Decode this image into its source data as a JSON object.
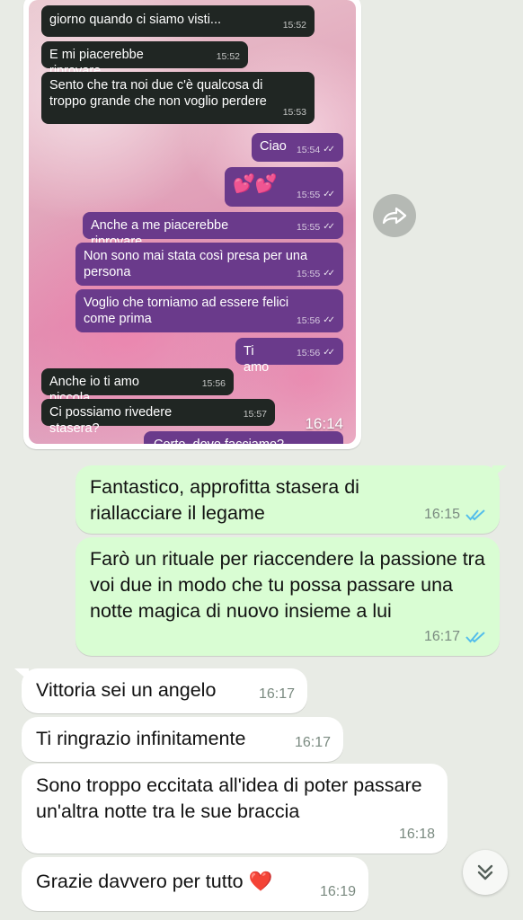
{
  "screenshot": {
    "messages": [
      {
        "dir": "in",
        "text": "giorno quando ci siamo visti...",
        "time": "15:52"
      },
      {
        "dir": "in",
        "text": "E mi piacerebbe riprovare",
        "time": "15:52"
      },
      {
        "dir": "in",
        "text": "Sento che tra noi due c'è qualcosa di troppo grande che non voglio perdere",
        "time": "15:53"
      },
      {
        "dir": "out",
        "text": "Ciao",
        "time": "15:54"
      },
      {
        "dir": "out",
        "text": "💕💕",
        "time": "15:55"
      },
      {
        "dir": "out",
        "text": "Anche a me piacerebbe riprovare",
        "time": "15:55"
      },
      {
        "dir": "out",
        "text": "Non sono mai stata così presa per una persona",
        "time": "15:55"
      },
      {
        "dir": "out",
        "text": "Voglio che torniamo ad essere felici come prima",
        "time": "15:56"
      },
      {
        "dir": "out",
        "text": "Ti amo",
        "time": "15:56"
      },
      {
        "dir": "in",
        "text": "Anche io ti amo piccola",
        "time": "15:56"
      },
      {
        "dir": "in",
        "text": "Ci possiamo rivedere stasera?",
        "time": "15:57"
      },
      {
        "dir": "out",
        "text": "Certo, dove facciamo?",
        "time": ""
      }
    ],
    "overlay_time": "16:14"
  },
  "chat": {
    "messages": [
      {
        "dir": "out",
        "text": "Fantastico, approfitta stasera di riallacciare il legame",
        "time": "16:15",
        "status": "read"
      },
      {
        "dir": "out",
        "text": "Farò un rituale per riaccendere la passione tra voi due in modo che tu possa passare una notte magica di nuovo insieme a lui",
        "time": "16:17",
        "status": "read"
      },
      {
        "dir": "in",
        "text": "Vittoria sei un angelo",
        "time": "16:17"
      },
      {
        "dir": "in",
        "text": "Ti ringrazio infinitamente",
        "time": "16:17"
      },
      {
        "dir": "in",
        "text": "Sono troppo eccitata all'idea di poter passare un'altra notte tra le sue braccia",
        "time": "16:18"
      },
      {
        "dir": "in",
        "text": "Grazie davvero per tutto ❤️",
        "time": "16:19"
      }
    ]
  },
  "icons": {
    "forward": "forward-icon",
    "scroll_down": "chevrons-down-icon",
    "read_ticks": "double-check-icon"
  },
  "colors": {
    "chat_bg": "#e8ebe5",
    "outgoing_bubble": "#d9fdd3",
    "incoming_bubble": "#ffffff",
    "read_tick": "#53bdeb",
    "embedded_out": "#6a3a8b",
    "embedded_in": "#202623"
  }
}
